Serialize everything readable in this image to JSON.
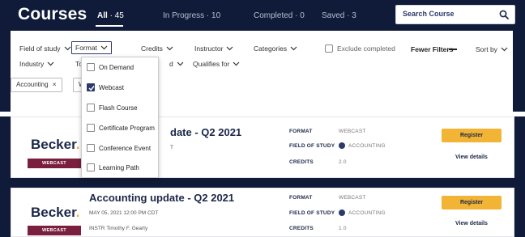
{
  "page": {
    "title": "Courses"
  },
  "tabs": [
    {
      "label": "All",
      "count": "· 45"
    },
    {
      "label": "In Progress",
      "count": "· 10"
    },
    {
      "label": "Completed",
      "count": "· 0"
    },
    {
      "label": "Saved",
      "count": "· 3"
    }
  ],
  "search": {
    "placeholder": "Search Course"
  },
  "filters": {
    "field_of_study": "Field of study",
    "format": "Format",
    "credits": "Credits",
    "instructor": "Instructor",
    "categories": "Categories",
    "exclude_completed": "Exclude completed",
    "fewer_filters": "Fewer Filters",
    "sort_by": "Sort by",
    "industry": "Industry",
    "to_partial": "To",
    "d_partial": "d",
    "qualifies_for": "Qualifies for"
  },
  "chips": [
    {
      "label": "Accounting",
      "remove": "×"
    },
    {
      "label": "W"
    }
  ],
  "format_dropdown": {
    "options": [
      {
        "label": "On Demand",
        "checked": false
      },
      {
        "label": "Webcast",
        "checked": true
      },
      {
        "label": "Flash Course",
        "checked": false
      },
      {
        "label": "Certificate Program",
        "checked": false
      },
      {
        "label": "Conference Event",
        "checked": false
      },
      {
        "label": "Learning Path",
        "checked": false
      }
    ]
  },
  "courses": [
    {
      "logo": "Becker",
      "logo_dot": ".",
      "format_badge": "WEBCAST",
      "title": "date - Q2 2021",
      "meta_line1": "T",
      "meta_line2": "",
      "labels": {
        "format": "FORMAT",
        "field": "FIELD OF STUDY",
        "credits": "CREDITS"
      },
      "format": "WEBCAST",
      "field": "ACCOUNTING",
      "credits": "2.0",
      "register": "Register",
      "details": "View details"
    },
    {
      "logo": "Becker",
      "logo_dot": ".",
      "format_badge": "WEBCAST",
      "title": "Accounting update - Q2 2021",
      "meta_line1": "MAY 05, 2021   12:00 PM CDT",
      "meta_line2": "INSTR   Timothy F. Gearty",
      "labels": {
        "format": "FORMAT",
        "field": "FIELD OF STUDY",
        "credits": "CREDITS"
      },
      "format": "WEBCAST",
      "field": "ACCOUNTING",
      "credits": "1.0",
      "register": "Register",
      "details": "View details"
    }
  ],
  "colors": {
    "navy": "#0f1b38",
    "accent_yellow": "#f1b434",
    "webcast_badge": "#7a1f3d",
    "checkbox_checked": "#2c3a6b"
  }
}
